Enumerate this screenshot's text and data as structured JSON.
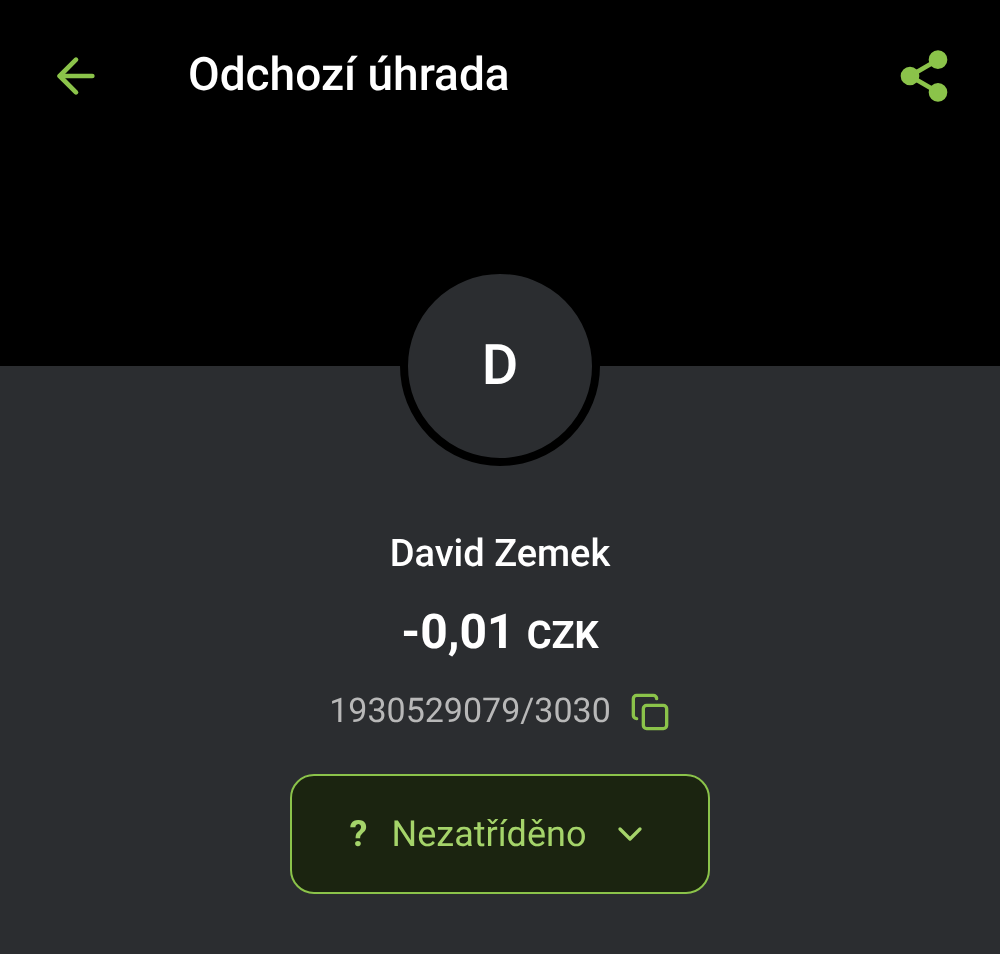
{
  "header": {
    "title": "Odchozí úhrada"
  },
  "counterparty": {
    "initial": "D",
    "name": "David Zemek",
    "amount": "-0,01",
    "currency": "CZK",
    "account": "1930529079/3030"
  },
  "category": {
    "icon": "?",
    "label": "Nezatříděno"
  }
}
